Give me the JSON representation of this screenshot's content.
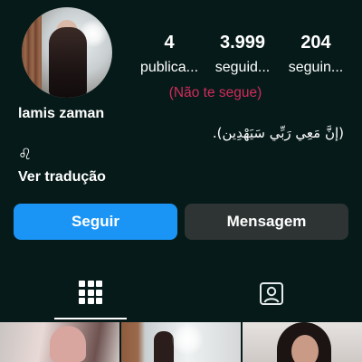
{
  "profile": {
    "name": "lamis zaman",
    "bio_line": "(إنَّ مَعِي رَبِّي سَيَهْدِين).",
    "bio_sign": "♌",
    "translate_label": "Ver tradução",
    "relationship_status": "(Não te segue)"
  },
  "stats": [
    {
      "value": "4",
      "label": "publica..."
    },
    {
      "value": "3.999",
      "label": "seguid..."
    },
    {
      "value": "204",
      "label": "seguin..."
    }
  ],
  "actions": {
    "follow_label": "Seguir",
    "message_label": "Mensagem"
  },
  "tabs": [
    {
      "icon": "grid-icon",
      "selected": true
    },
    {
      "icon": "tagged-person-icon",
      "selected": false
    }
  ],
  "colors": {
    "background": "#061b19",
    "follow_button": "#1b95f5",
    "message_button": "#2d3433",
    "not_following_text": "#d12a5b",
    "text": "#ffffff"
  }
}
